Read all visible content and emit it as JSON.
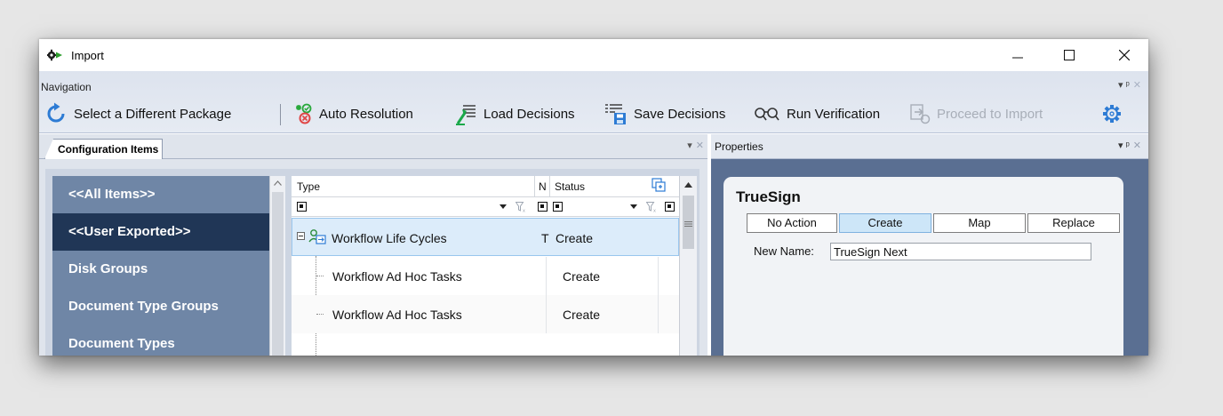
{
  "window": {
    "title": "Import",
    "controls": {
      "minimize": "minimize",
      "maximize": "maximize",
      "close": "close"
    }
  },
  "navigation": {
    "title": "Navigation",
    "toolbar": {
      "select_package": "Select a Different Package",
      "auto_resolution": "Auto Resolution",
      "load_decisions": "Load Decisions",
      "save_decisions": "Save Decisions",
      "run_verification": "Run Verification",
      "proceed_to_import": "Proceed to Import"
    }
  },
  "config_panel": {
    "tab_label": "Configuration Items",
    "categories": [
      {
        "label": "<<All Items>>",
        "selected": false
      },
      {
        "label": "<<User Exported>>",
        "selected": true
      },
      {
        "label": "Disk Groups",
        "selected": false
      },
      {
        "label": "Document Type Groups",
        "selected": false
      },
      {
        "label": "Document Types",
        "selected": false
      }
    ],
    "grid": {
      "columns": {
        "type": "Type",
        "n": "N",
        "status": "Status"
      },
      "rows": [
        {
          "type": "Workflow Life Cycles",
          "n": "T",
          "status": "Create",
          "level": 0,
          "selected": true
        },
        {
          "type": "Workflow Ad Hoc Tasks",
          "n": "",
          "status": "Create",
          "level": 1,
          "selected": false
        },
        {
          "type": "Workflow Ad Hoc Tasks",
          "n": "",
          "status": "Create",
          "level": 1,
          "selected": false
        }
      ]
    }
  },
  "properties_panel": {
    "title": "Properties",
    "item_name": "TrueSign",
    "options": [
      "No Action",
      "Create",
      "Map",
      "Replace"
    ],
    "active_option": "Create",
    "new_name_label": "New Name:",
    "new_name_value": "TrueSign Next"
  },
  "colors": {
    "selected_category": "#203656",
    "category_list": "#6f86a6",
    "selected_row": "#dcecfa",
    "accent_blue": "#2d7bd4"
  }
}
